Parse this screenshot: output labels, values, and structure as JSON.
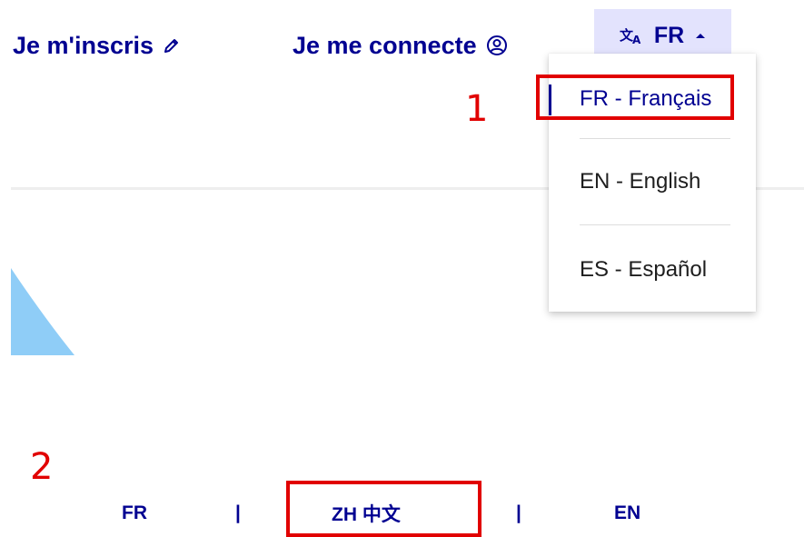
{
  "header": {
    "signup_label": "Je m'inscris",
    "signup_icon": "pencil-icon",
    "login_label": "Je me connecte",
    "login_icon": "user-circle-icon",
    "language_button": {
      "icon": "translate-icon",
      "current": "FR",
      "caret_icon": "caret-up-icon"
    }
  },
  "language_menu": {
    "items": [
      {
        "label": "FR - Français",
        "active": true
      },
      {
        "label": "EN - English",
        "active": false
      },
      {
        "label": "ES - Español",
        "active": false
      }
    ]
  },
  "annotations": {
    "marker_1": "1",
    "marker_2": "2",
    "highlight_color": "#e10000"
  },
  "footer_languages": {
    "items": [
      "FR",
      "ZH 中文",
      "EN"
    ],
    "separator": "|"
  },
  "colors": {
    "brand_blue": "#000091",
    "lang_button_bg": "#e3e3fd",
    "deco_blue": "#8fcdf7"
  }
}
